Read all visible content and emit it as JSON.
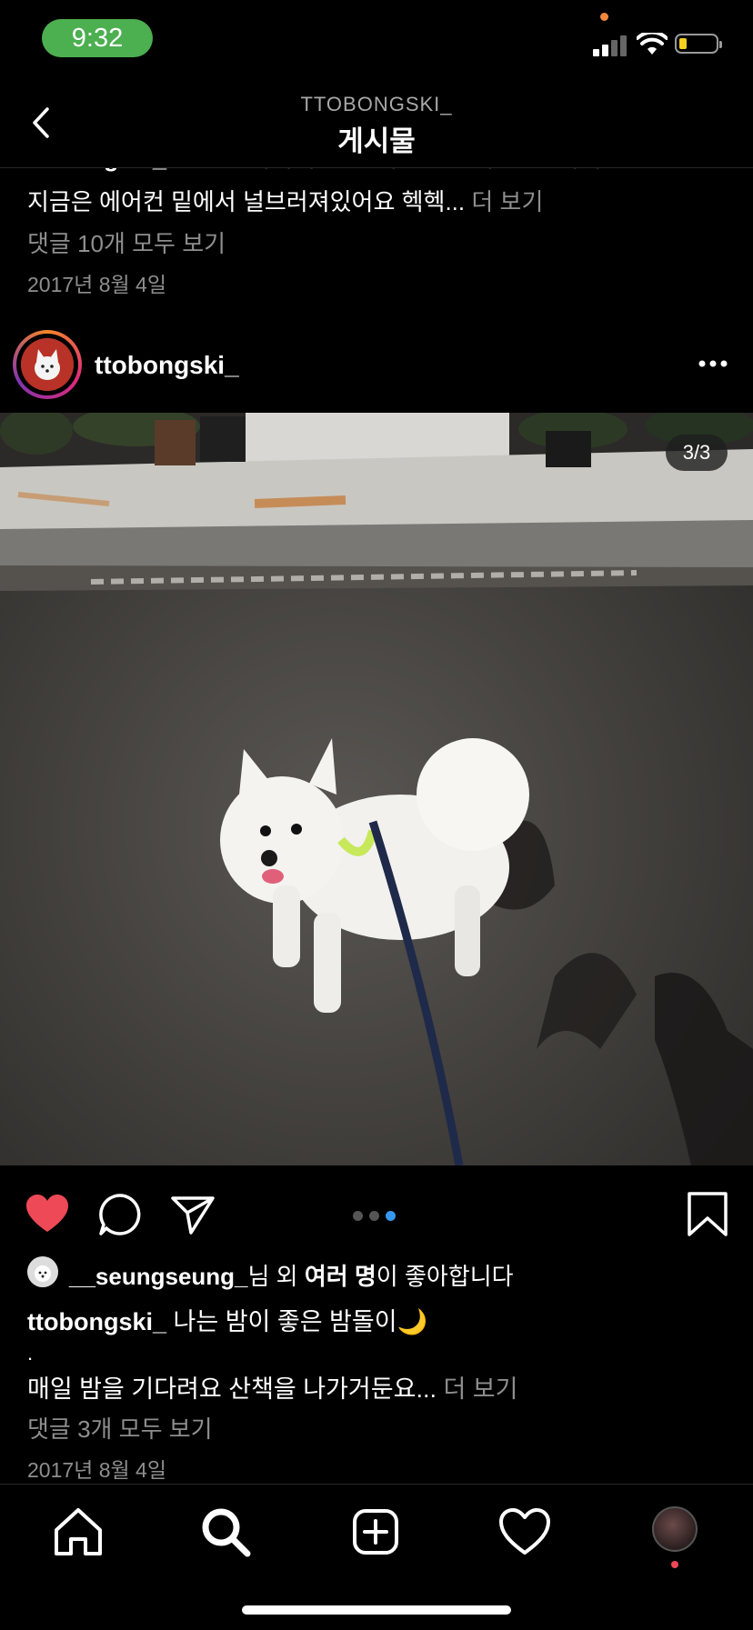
{
  "status_bar": {
    "time": "9:32",
    "battery_level": 0.2,
    "time_pill_color": "#4caf50"
  },
  "header": {
    "subtitle": "TTOBONGSKI_",
    "title": "게시물",
    "back_icon": "chevron-left-icon"
  },
  "previous_post": {
    "cut_username": "ttobongski_",
    "cut_text": "오늘은 더워서 밥 옆에만 있었어요 😣 헥헥",
    "caption_line": "지금은 에어컨 밑에서 널브러져있어요 헥헥...",
    "more": "더 보기",
    "comments_link": "댓글 10개 모두 보기",
    "date": "2017년 8월 4일"
  },
  "post": {
    "username": "ttobongski_",
    "more_icon": "ellipsis-icon",
    "counter": "3/3",
    "carousel": {
      "count": 3,
      "active": 3
    },
    "likes": {
      "user": "__seungseung_",
      "text_mid": "님 외 ",
      "text_bold": "여러 명",
      "text_end": "이 좋아합니다"
    },
    "caption": {
      "username": "ttobongski_",
      "text": "나는 밤이 좋은 밤돌이🌙",
      "dot_line": ".",
      "line2": "매일 밤을 기다려요 산책을 나가거둔요...",
      "more": "더 보기"
    },
    "comments_link": "댓글 3개 모두 보기",
    "date": "2017년 8월 4일",
    "like_color": "#ed4956"
  },
  "nav": {
    "items": [
      "home-icon",
      "search-icon",
      "add-post-icon",
      "activity-heart-icon",
      "profile-avatar"
    ]
  }
}
